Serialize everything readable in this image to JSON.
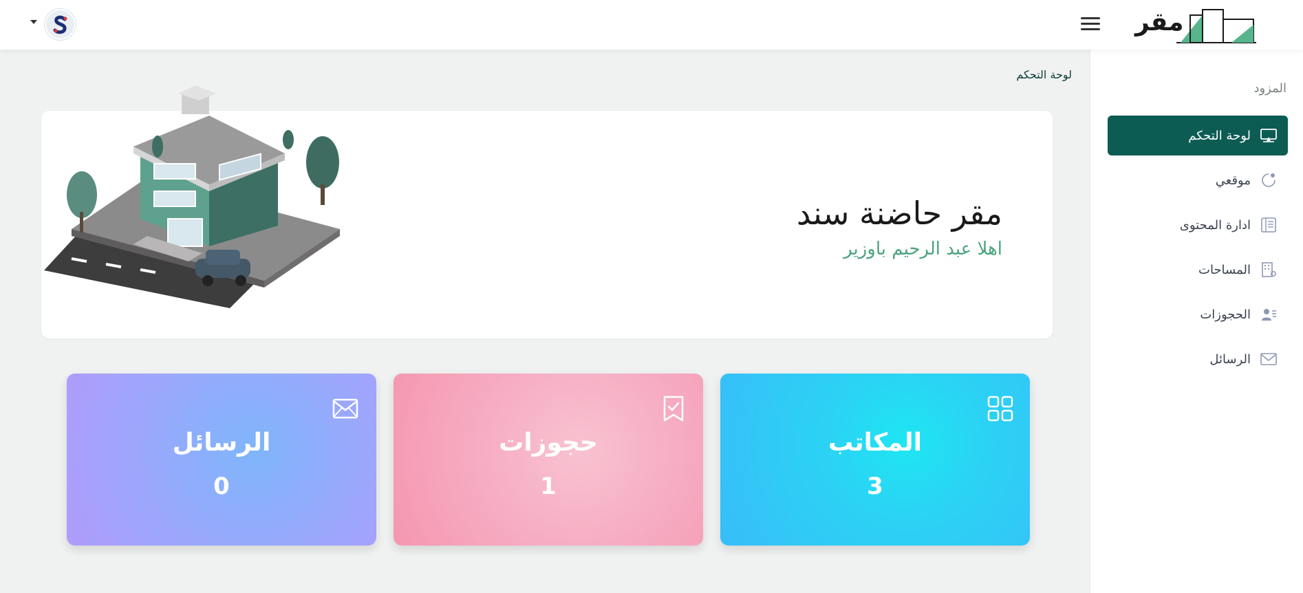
{
  "brand": {
    "name": "مقر",
    "accent": "#0d5c54"
  },
  "header": {
    "menu_icon": "hamburger-icon",
    "avatar_icon": "s-logo-avatar"
  },
  "sidebar": {
    "heading": "المزود",
    "items": [
      {
        "label": "لوحة التحكم",
        "icon": "monitor-icon",
        "active": true
      },
      {
        "label": "موقعي",
        "icon": "web-icon",
        "active": false
      },
      {
        "label": "ادارة المحتوى",
        "icon": "content-icon",
        "active": false
      },
      {
        "label": "المساحات",
        "icon": "building-icon",
        "active": false
      },
      {
        "label": "الحجوزات",
        "icon": "people-icon",
        "active": false
      },
      {
        "label": "الرسائل",
        "icon": "mail-icon",
        "active": false
      }
    ]
  },
  "breadcrumb": "لوحة التحكم",
  "welcome": {
    "title": "مقر حاضنة سند",
    "subtitle": "اهلا عبد الرحيم باوزير",
    "subtitle_color": "#4ba37e"
  },
  "stats": [
    {
      "title": "المكاتب",
      "value": "3",
      "icon": "grid-icon"
    },
    {
      "title": "حجوزات",
      "value": "1",
      "icon": "bookmark-check-icon"
    },
    {
      "title": "الرسائل",
      "value": "0",
      "icon": "envelope-icon"
    }
  ]
}
